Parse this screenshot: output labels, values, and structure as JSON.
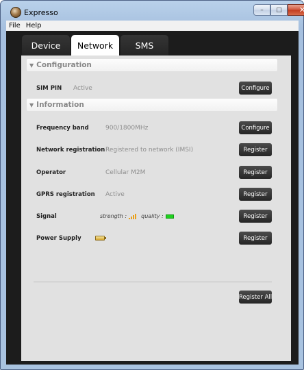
{
  "window": {
    "title": "Expresso"
  },
  "menu": [
    "File",
    "Help"
  ],
  "tabs": [
    {
      "label": "Device",
      "active": false
    },
    {
      "label": "Network",
      "active": true
    },
    {
      "label": "SMS",
      "active": false
    }
  ],
  "configuration": {
    "header": "Configuration",
    "sim_pin": {
      "label": "SIM PIN",
      "value": "Active",
      "button": "Configure"
    }
  },
  "information": {
    "header": "Information",
    "rows": [
      {
        "label": "Frequency band",
        "value": "900/1800MHz",
        "button": "Configure"
      },
      {
        "label": "Network registration",
        "value": "Registered to network (IMSI)",
        "button": "Register"
      },
      {
        "label": "Operator",
        "value": "Cellular M2M",
        "button": "Register"
      },
      {
        "label": "GPRS registration",
        "value": "Active",
        "button": "Register"
      }
    ],
    "signal": {
      "label": "Signal",
      "strength_label": "strength :",
      "quality_label": "quality :",
      "button": "Register"
    },
    "power": {
      "label": "Power Supply",
      "button": "Register"
    },
    "register_all": "Register All"
  },
  "colors": {
    "accent_dark": "#1c1c1c",
    "panel": "#e1e1e1",
    "quality_ok": "#20d020",
    "signal_bars": "#e8a01c"
  },
  "icons": [
    "app-icon",
    "minimize-icon",
    "maximize-icon",
    "close-icon",
    "chevron-down-icon",
    "signal-bars-icon",
    "battery-icon"
  ]
}
